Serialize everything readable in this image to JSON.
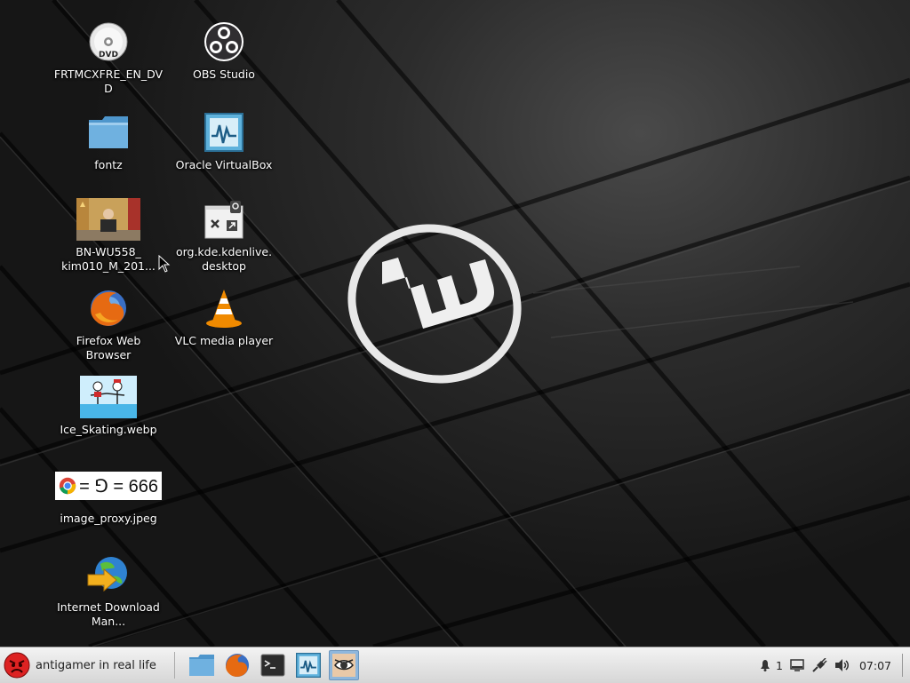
{
  "desktop": {
    "icons": [
      {
        "label": "FRTMCXFRE_EN_DVD",
        "icon": "dvd-icon"
      },
      {
        "label": "OBS Studio",
        "icon": "obs-icon"
      },
      {
        "label": "fontz",
        "icon": "folder-icon"
      },
      {
        "label": "Oracle VirtualBox",
        "icon": "virtualbox-icon"
      },
      {
        "label": "BN-WU558_ kim010_M_201...",
        "icon": "image-thumbnail-icon"
      },
      {
        "label": "org.kde.kdenlive. desktop",
        "icon": "desktop-file-icon"
      },
      {
        "label": "Firefox Web Browser",
        "icon": "firefox-icon"
      },
      {
        "label": "VLC media player",
        "icon": "vlc-icon"
      },
      {
        "label": "Ice_Skating.webp",
        "icon": "image-thumbnail-icon"
      },
      {
        "label": "image_proxy.jpeg",
        "icon": "image-thumbnail-icon"
      },
      {
        "label": "Internet Download Man...",
        "icon": "idm-icon"
      }
    ],
    "thumb_text": "= ⅁ = 666"
  },
  "taskbar": {
    "menu_label": "antigamer in real life",
    "launchers": [
      "folder-icon",
      "firefox-icon",
      "terminal-icon",
      "virtualbox-icon",
      "eye-icon"
    ],
    "notification_count": "1",
    "clock": "07:07"
  },
  "colors": {
    "taskbar_bg": "#e4e4e4",
    "active_launcher": "#8fb7dc",
    "folder": "#6fb1e0",
    "vlc_orange": "#f08a00"
  }
}
